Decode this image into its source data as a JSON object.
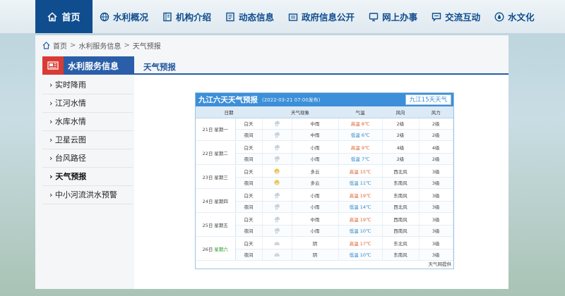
{
  "nav": {
    "home_label": "首页",
    "items": [
      {
        "label": "水利概况",
        "icon": "globe-icon"
      },
      {
        "label": "机构介绍",
        "icon": "book-icon"
      },
      {
        "label": "动态信息",
        "icon": "document-icon"
      },
      {
        "label": "政府信息公开",
        "icon": "folder-icon"
      },
      {
        "label": "网上办事",
        "icon": "monitor-icon"
      },
      {
        "label": "交流互动",
        "icon": "chat-icon"
      },
      {
        "label": "水文化",
        "icon": "water-drop-icon"
      }
    ]
  },
  "breadcrumb": {
    "home": "首页",
    "sep": ">",
    "section": "水利服务信息",
    "current": "天气预报"
  },
  "sidebar": {
    "title": "水利服务信息",
    "items": [
      {
        "label": "实时降雨"
      },
      {
        "label": "江河水情"
      },
      {
        "label": "水库水情"
      },
      {
        "label": "卫星云图"
      },
      {
        "label": "台风路径"
      },
      {
        "label": "天气预报"
      },
      {
        "label": "中小河流洪水预警"
      }
    ]
  },
  "main": {
    "title": "天气预报"
  },
  "weather": {
    "title": "九江六天天气预报",
    "published": "(2022-03-21 07:00发布)",
    "link_label": "九江15天天气",
    "headers": [
      "日期",
      "天气现象",
      "气温",
      "风向",
      "风力"
    ],
    "high_label": "高温",
    "low_label": "低温",
    "day_label": "白天",
    "night_label": "夜间",
    "days": [
      {
        "date": "21日",
        "weekday": "星期一",
        "day_weather": "中雨",
        "night_weather": "中雨",
        "high": "8℃",
        "low": "6℃",
        "day_wind_dir": "2级",
        "night_wind_dir": "2级",
        "day_wind": "2级",
        "night_wind": "2级",
        "day_icon": "rain-icon",
        "night_icon": "rain-icon"
      },
      {
        "date": "22日",
        "weekday": "星期二",
        "day_weather": "小雨",
        "night_weather": "小雨",
        "high": "9℃",
        "low": "7℃",
        "day_wind_dir": "4级",
        "night_wind_dir": "2级",
        "day_wind": "4级",
        "night_wind": "2级",
        "day_icon": "rain-icon",
        "night_icon": "rain-icon"
      },
      {
        "date": "23日",
        "weekday": "星期三",
        "day_weather": "多云",
        "night_weather": "多云",
        "high": "15℃",
        "low": "11℃",
        "day_wind_dir": "西北风",
        "night_wind_dir": "东南风",
        "day_wind": "3级",
        "night_wind": "3级",
        "day_icon": "cloudy-sun-icon",
        "night_icon": "cloudy-sun-icon"
      },
      {
        "date": "24日",
        "weekday": "星期四",
        "day_weather": "小雨",
        "night_weather": "小雨",
        "high": "19℃",
        "low": "14℃",
        "day_wind_dir": "东南风",
        "night_wind_dir": "西北风",
        "day_wind": "3级",
        "night_wind": "3级",
        "day_icon": "rain-icon",
        "night_icon": "rain-icon"
      },
      {
        "date": "25日",
        "weekday": "星期五",
        "day_weather": "中雨",
        "night_weather": "小雨",
        "high": "19℃",
        "low": "10℃",
        "day_wind_dir": "西南风",
        "night_wind_dir": "西南风",
        "day_wind": "3级",
        "night_wind": "3级",
        "day_icon": "rain-icon",
        "night_icon": "rain-icon"
      },
      {
        "date": "26日",
        "weekday": "星期六",
        "weekday_holiday": true,
        "day_weather": "阴",
        "night_weather": "阴",
        "high": "17℃",
        "low": "10℃",
        "day_wind_dir": "东北风",
        "night_wind_dir": "东南风",
        "day_wind": "3级",
        "night_wind": "3级",
        "day_icon": "overcast-icon",
        "night_icon": "overcast-icon"
      }
    ],
    "footer": "天气网提供"
  },
  "colors": {
    "nav_active": "#0f4d8f",
    "sidebar_head": "#2a5ea8",
    "sidebar_badge": "#d93b35",
    "widget_head": "#3c8fd8",
    "high_temp": "#e0602c",
    "low_temp": "#2c86c8"
  }
}
